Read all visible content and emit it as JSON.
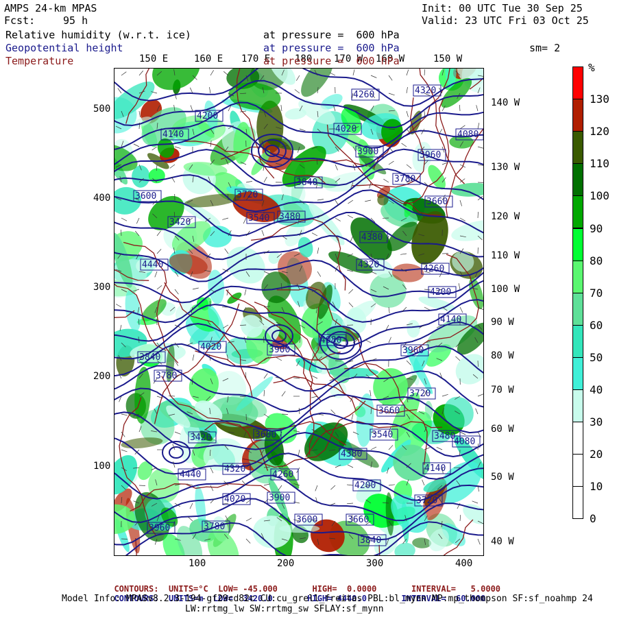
{
  "header": {
    "title": "AMPS 24-km MPAS",
    "fcst_label": "Fcst:",
    "fcst_value": "95 h",
    "init": "Init: 00 UTC Tue 30 Sep 25",
    "valid": "Valid: 23 UTC Fri 03 Oct 25",
    "field1": "Relative humidity (w.r.t. ice)",
    "field2": "Geopotential height",
    "field3": "Temperature",
    "pressure_label": "at pressure =  600 hPa",
    "smoothing": "sm= 2"
  },
  "colors": {
    "title_text": "#000000",
    "height_text": "#1a1a8c",
    "temp_text": "#8b1a1a",
    "height_contour": "#1a1a8c",
    "temp_contour": "#8b1a1a"
  },
  "lon_top": [
    "150 E",
    "160 E",
    "170 E",
    "180",
    "170 W",
    "160 W",
    "150 W"
  ],
  "lon_right": [
    "140 W",
    "130 W",
    "120 W",
    "110 W",
    "100 W",
    "90 W",
    "80 W",
    "70 W",
    "60 W",
    "50 W",
    "40 W"
  ],
  "y_ticks": [
    "500",
    "400",
    "300",
    "200",
    "100"
  ],
  "x_ticks": [
    "100",
    "200",
    "300",
    "400"
  ],
  "colorbar": {
    "unit": "%",
    "labels": [
      "130",
      "120",
      "110",
      "100",
      "90",
      "80",
      "70",
      "60",
      "50",
      "40",
      "30",
      "20",
      "10",
      "0"
    ],
    "colors": [
      "#ff0000",
      "#b01e00",
      "#3a5a00",
      "#007000",
      "#00a800",
      "#00ff33",
      "#5af770",
      "#5ee098",
      "#33e6bb",
      "#40f0d8",
      "#c8fcec",
      "#ffffff",
      "#ffffff",
      "#ffffff"
    ]
  },
  "height_labels": [
    "4320",
    "4260",
    "4200",
    "4140",
    "4080",
    "4020",
    "3960",
    "3900",
    "3840",
    "3780",
    "3720",
    "3660",
    "3600",
    "3540",
    "3480",
    "3420",
    "4380",
    "4440"
  ],
  "footer": {
    "line1": {
      "contours": "CONTOURS:",
      "units": "UNITS=°C",
      "low": "LOW= -45.000",
      "high": "HIGH=  0.0000",
      "interval": "INTERVAL=   5.0000"
    },
    "line2": {
      "contours": "CONTOURS:",
      "units": "UNITS=m",
      "low": "LOW=  3420.0",
      "high": "HIGH= 4440.0",
      "interval": "INTERVAL=  60.000"
    },
    "model_info_1": "Model Info: MPASv8.2.3-194-gf29cd82c CU:cu_grell_freitas PBL:bl_mynn MP:mp_thompson SF:sf_noahmp 24",
    "model_info_2": "LW:rrtmg_lw SW:rrtmg_sw SFLAY:sf_mynn"
  }
}
